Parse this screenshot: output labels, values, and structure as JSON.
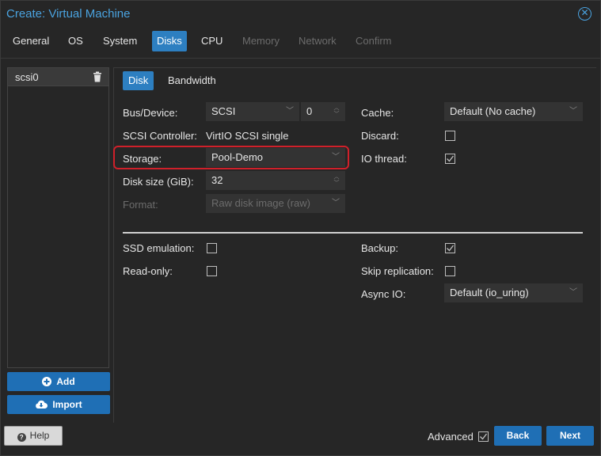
{
  "window": {
    "title": "Create: Virtual Machine"
  },
  "tabs": [
    {
      "label": "General",
      "state": "normal"
    },
    {
      "label": "OS",
      "state": "normal"
    },
    {
      "label": "System",
      "state": "normal"
    },
    {
      "label": "Disks",
      "state": "active"
    },
    {
      "label": "CPU",
      "state": "normal"
    },
    {
      "label": "Memory",
      "state": "disabled"
    },
    {
      "label": "Network",
      "state": "disabled"
    },
    {
      "label": "Confirm",
      "state": "disabled"
    }
  ],
  "disk_list": {
    "items": [
      "scsi0"
    ],
    "add_label": "Add",
    "import_label": "Import"
  },
  "subtabs": {
    "disk": "Disk",
    "bandwidth": "Bandwidth"
  },
  "form": {
    "bus_device": {
      "label": "Bus/Device:",
      "bus": "SCSI",
      "device": "0"
    },
    "scsi_controller": {
      "label": "SCSI Controller:",
      "value": "VirtIO SCSI single"
    },
    "storage": {
      "label": "Storage:",
      "value": "Pool-Demo"
    },
    "disk_size": {
      "label": "Disk size (GiB):",
      "value": "32"
    },
    "format": {
      "label": "Format:",
      "value": "Raw disk image (raw)"
    },
    "cache": {
      "label": "Cache:",
      "value": "Default (No cache)"
    },
    "discard": {
      "label": "Discard:",
      "checked": false
    },
    "io_thread": {
      "label": "IO thread:",
      "checked": true
    },
    "ssd_emulation": {
      "label": "SSD emulation:",
      "checked": false
    },
    "read_only": {
      "label": "Read-only:",
      "checked": false
    },
    "backup": {
      "label": "Backup:",
      "checked": true
    },
    "skip_replication": {
      "label": "Skip replication:",
      "checked": false
    },
    "async_io": {
      "label": "Async IO:",
      "value": "Default (io_uring)"
    }
  },
  "footer": {
    "help": "Help",
    "advanced": "Advanced",
    "advanced_checked": true,
    "back": "Back",
    "next": "Next"
  },
  "colors": {
    "accent": "#2d7fc1",
    "highlight": "#d0202a",
    "background": "#262626"
  }
}
